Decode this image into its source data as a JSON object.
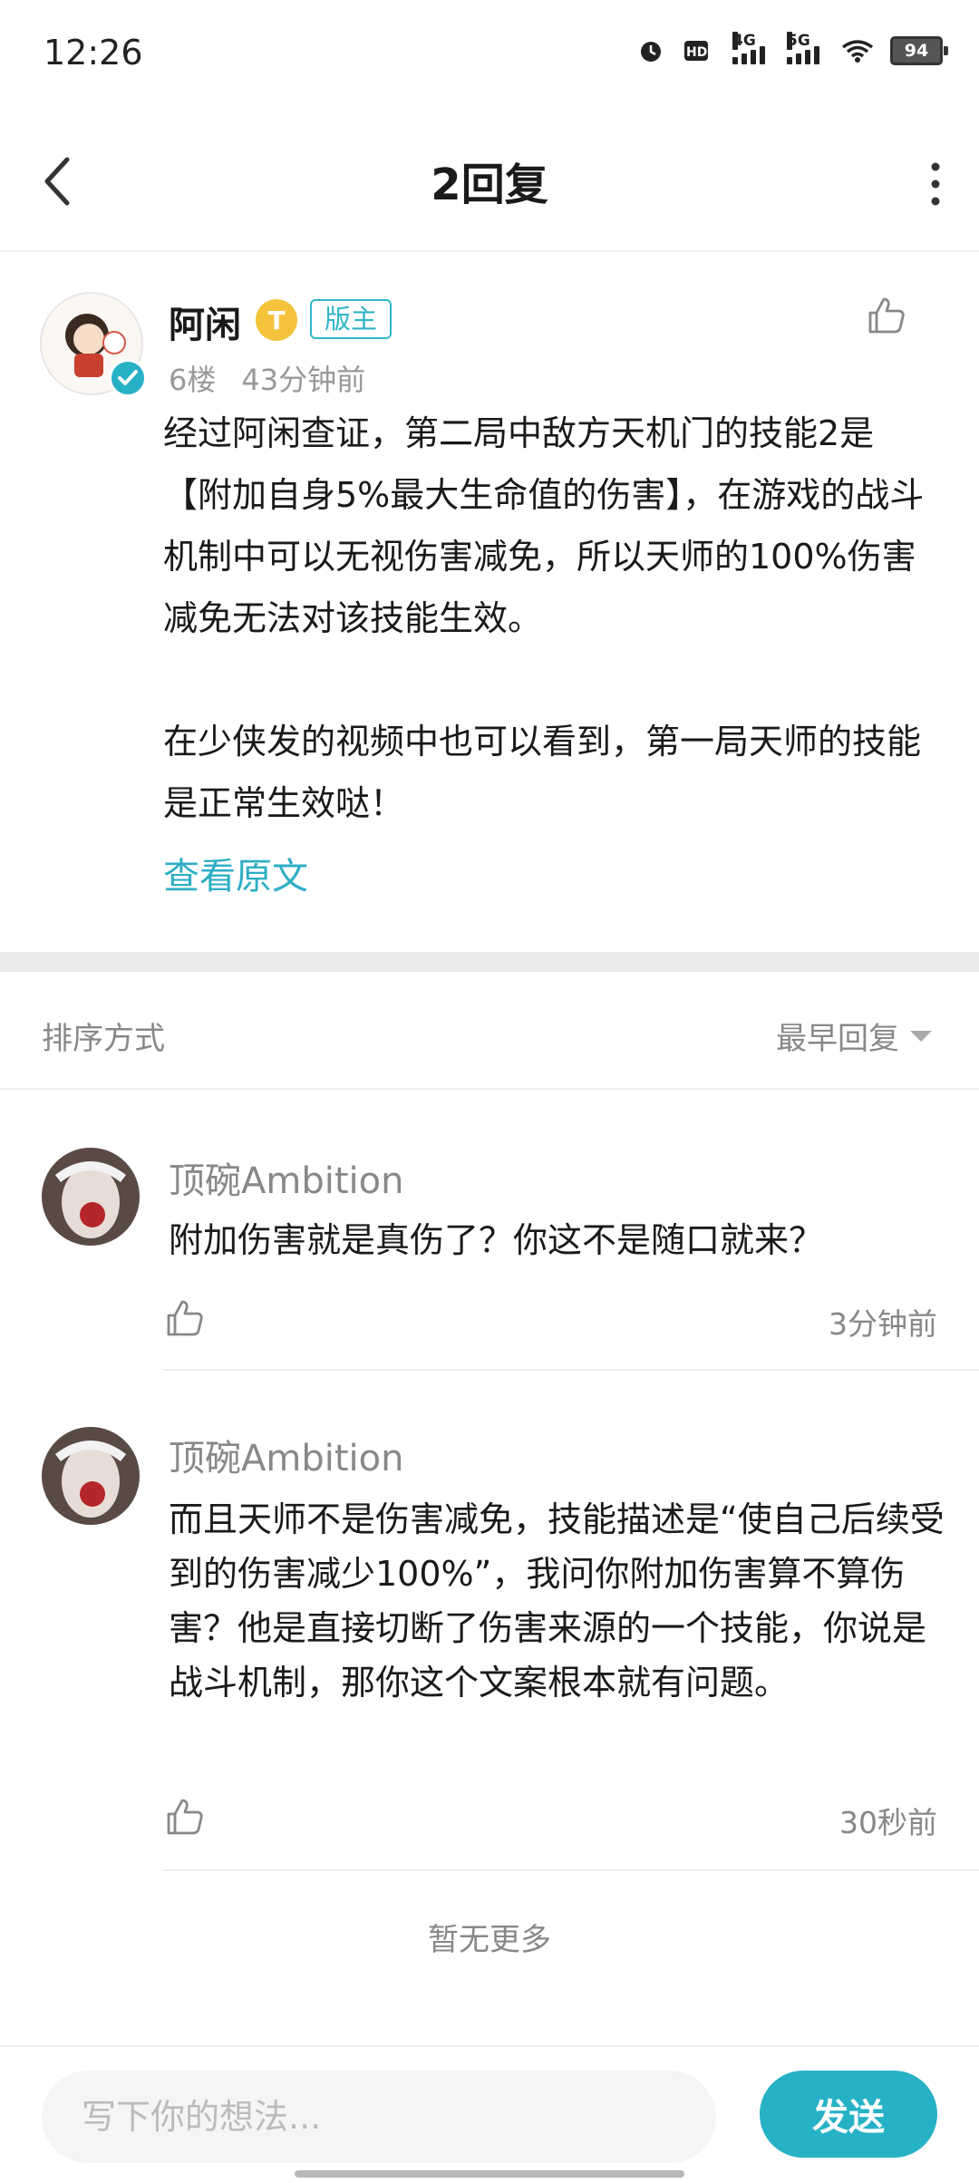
{
  "status_bar": {
    "time": "12:26",
    "network_1": "4G",
    "network_2": "5G",
    "battery": "94"
  },
  "header": {
    "title": "2回复"
  },
  "post": {
    "author": "阿闲",
    "level_badge": "T",
    "role_badge": "版主",
    "floor": "6楼",
    "time": "43分钟前",
    "body": "经过阿闲查证，第二局中敌方天机门的技能2是【附加自身5%最大生命值的伤害】，在游戏的战斗机制中可以无视伤害减免，所以天师的100%伤害减免无法对该技能生效。\n\n在少侠发的视频中也可以看到，第一局天师的技能是正常生效哒！",
    "view_original": "查看原文"
  },
  "sort": {
    "label": "排序方式",
    "value": "最早回复"
  },
  "replies": [
    {
      "name": "顶碗Ambition",
      "text": "附加伤害就是真伤了？你这不是随口就来？",
      "time": "3分钟前"
    },
    {
      "name": "顶碗Ambition",
      "text": "而且天师不是伤害减免，技能描述是“使自己后续受到的伤害减少100%”，我问你附加伤害算不算伤害？他是直接切断了伤害来源的一个技能，你说是战斗机制，那你这个文案根本就有问题。",
      "time": "30秒前"
    }
  ],
  "no_more": "暂无更多",
  "composer": {
    "placeholder": "写下你的想法...",
    "send_label": "发送"
  },
  "colors": {
    "accent": "#26b1c6",
    "link": "#2eaec5",
    "gold": "#f5c33b"
  }
}
